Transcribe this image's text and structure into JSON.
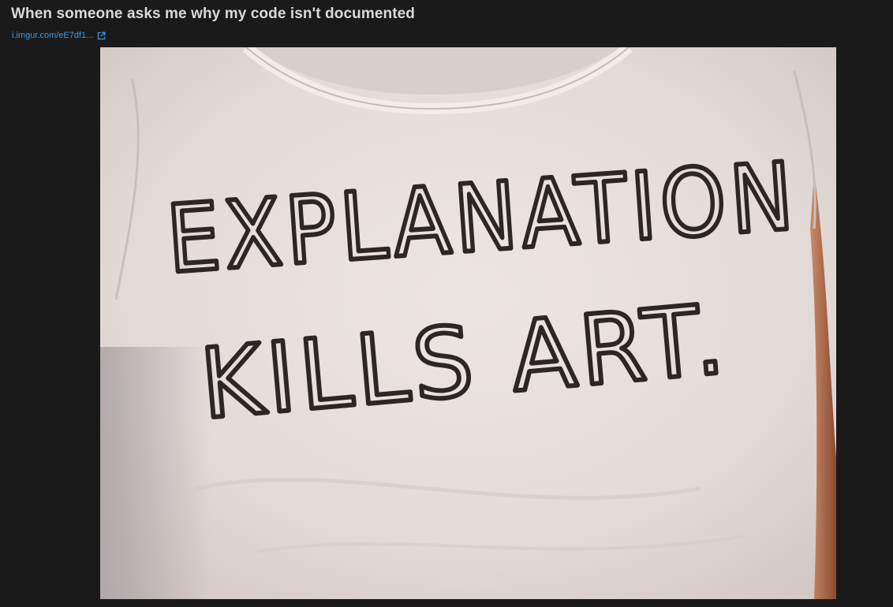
{
  "post": {
    "title": "When someone asks me why my code isn't documented",
    "link_text": "i.imgur.com/eE7df1...",
    "link_icon": "external-link-icon"
  },
  "image": {
    "shirt_line_1": "EXPLANATION",
    "shirt_line_2": "KILLS ART."
  },
  "colors": {
    "background": "#1a1a1b",
    "title": "#d7dadc",
    "link": "#3b9ae1",
    "shirt": "#e6dfdc",
    "ink": "#2c2726"
  }
}
